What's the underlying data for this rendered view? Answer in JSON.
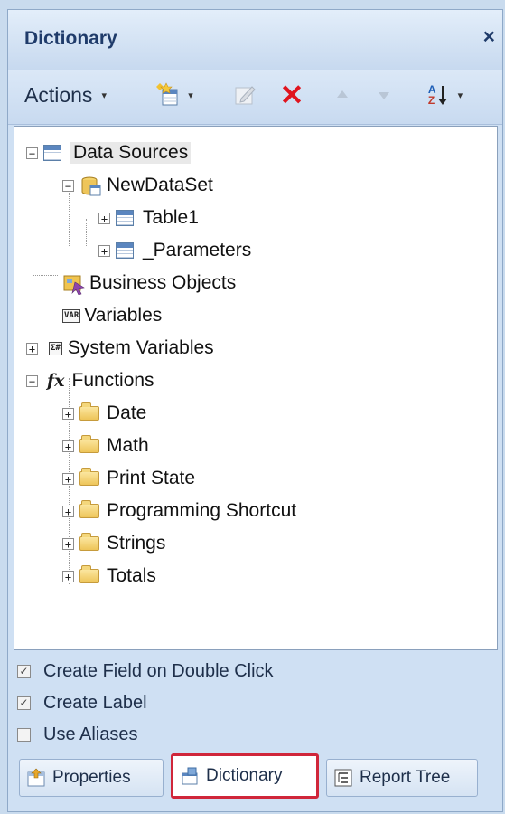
{
  "panel": {
    "title": "Dictionary",
    "close_glyph": "×"
  },
  "toolbar": {
    "actions_label": "Actions",
    "dropdown_glyph": "▾",
    "sort_glyph_top": "A",
    "sort_glyph_bottom": "Z",
    "delete_glyph": "✕"
  },
  "tree": {
    "data_sources": "Data Sources",
    "newdataset": "NewDataSet",
    "table1": "Table1",
    "parameters": "_Parameters",
    "business_objects": "Business Objects",
    "variables": "Variables",
    "system_variables": "System Variables",
    "functions": "Functions",
    "function_folders": [
      "Date",
      "Math",
      "Print State",
      "Programming Shortcut",
      "Strings",
      "Totals"
    ]
  },
  "options": [
    {
      "label": "Create Field on Double Click",
      "checked": true
    },
    {
      "label": "Create Label",
      "checked": true
    },
    {
      "label": "Use Aliases",
      "checked": false
    }
  ],
  "tabs": {
    "properties": "Properties",
    "dictionary": "Dictionary",
    "report_tree": "Report Tree",
    "active": "Dictionary"
  },
  "colors": {
    "accent_highlight": "#d0263a",
    "delete_red": "#e0141e",
    "title_blue": "#1f3b6a"
  },
  "icons": {
    "var_tag": "VAR",
    "sysvar_tag": "Σ#",
    "fx_glyph": "fx"
  }
}
